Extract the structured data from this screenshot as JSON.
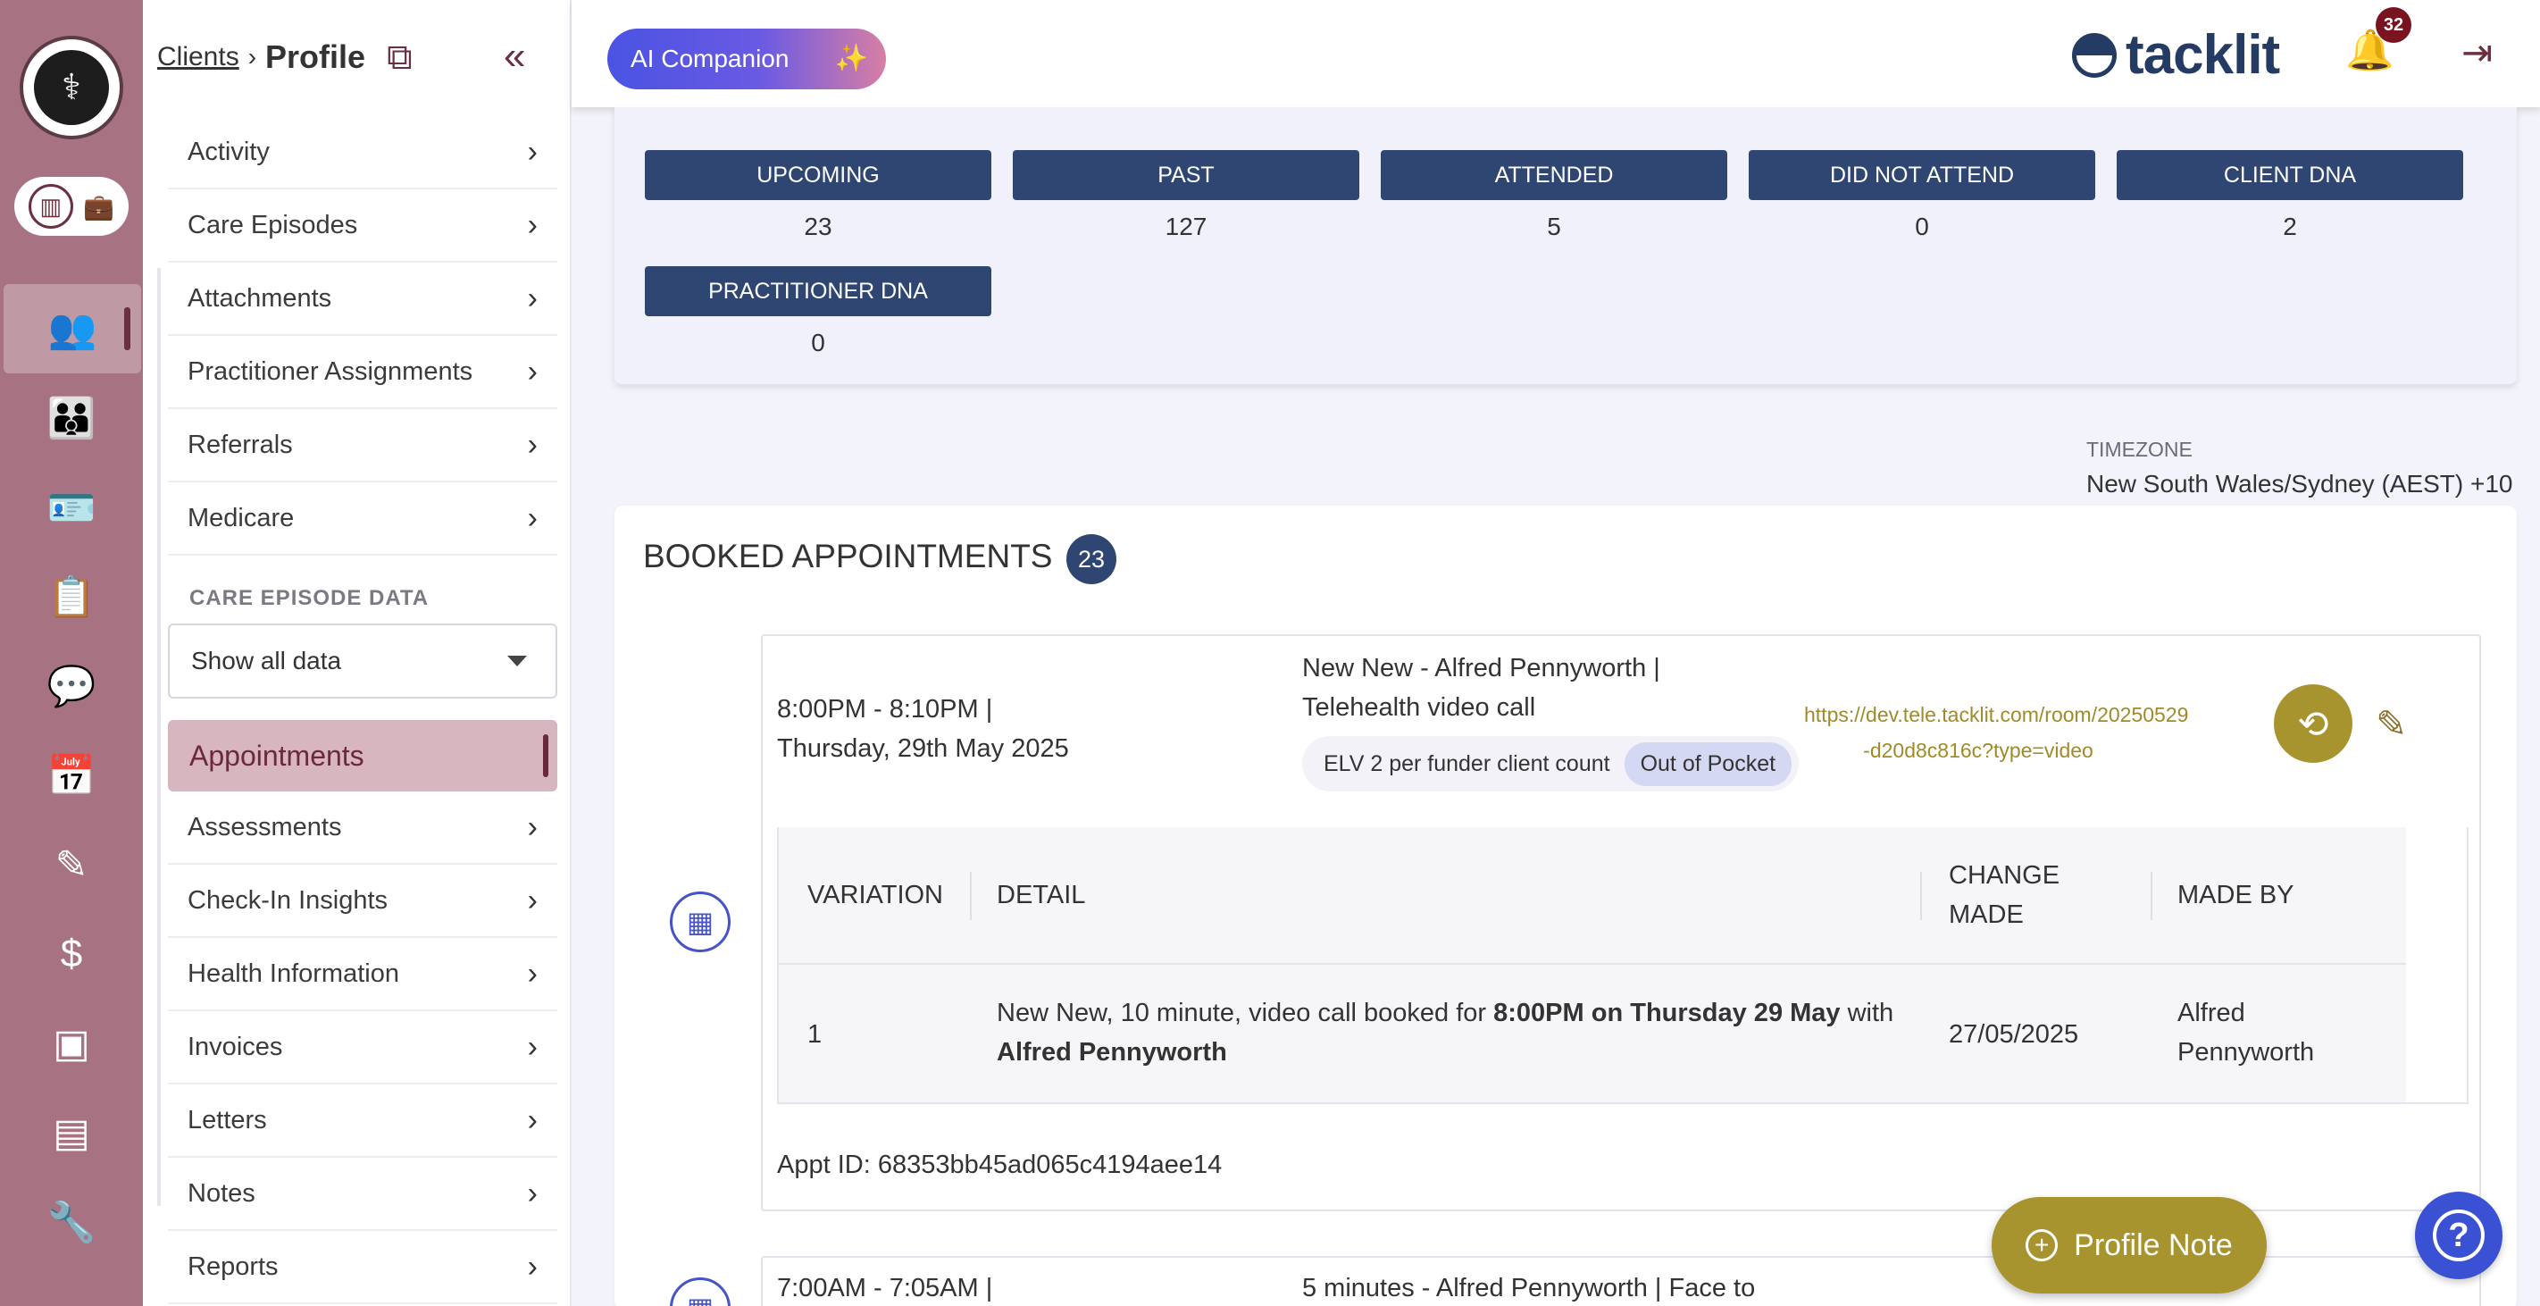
{
  "rail": {
    "logo_icon": "nurse-logo",
    "toggle_icons": [
      "building-icon",
      "briefcase-icon"
    ],
    "items": [
      {
        "icon": "users-icon",
        "glyph": "👥"
      },
      {
        "icon": "group-icon",
        "glyph": "👪"
      },
      {
        "icon": "id-card-icon",
        "glyph": "🪪"
      },
      {
        "icon": "clipboard-icon",
        "glyph": "📋"
      },
      {
        "icon": "chat-icon",
        "glyph": "💬"
      },
      {
        "icon": "calendar-icon",
        "glyph": "📅"
      },
      {
        "icon": "pen-icon",
        "glyph": "✎"
      },
      {
        "icon": "dollar-icon",
        "glyph": "$"
      },
      {
        "icon": "contact-card-icon",
        "glyph": "▣"
      },
      {
        "icon": "document-icon",
        "glyph": "▤"
      },
      {
        "icon": "wrench-icon",
        "glyph": "🔧"
      }
    ]
  },
  "breadcrumb": {
    "parent": "Clients",
    "separator": "›",
    "current": "Profile"
  },
  "menu_top": [
    "Activity",
    "Care Episodes",
    "Attachments",
    "Practitioner Assignments",
    "Referrals",
    "Medicare"
  ],
  "care_episode": {
    "label": "CARE EPISODE DATA",
    "selected": "Show all data"
  },
  "menu_active": "Appointments",
  "menu_bottom": [
    "Assessments",
    "Check-In Insights",
    "Health Information",
    "Invoices",
    "Letters",
    "Notes",
    "Reports"
  ],
  "topbar": {
    "ai_label": "AI Companion",
    "brand": "tacklit",
    "notifications": "32"
  },
  "stats": [
    {
      "label": "UPCOMING",
      "value": "23"
    },
    {
      "label": "PAST",
      "value": "127"
    },
    {
      "label": "ATTENDED",
      "value": "5"
    },
    {
      "label": "DID NOT ATTEND",
      "value": "0"
    },
    {
      "label": "CLIENT DNA",
      "value": "2"
    },
    {
      "label": "PRACTITIONER DNA",
      "value": "0"
    }
  ],
  "timezone": {
    "label": "TIMEZONE",
    "value": "New South Wales/Sydney (AEST) +10"
  },
  "booked": {
    "title": "BOOKED APPOINTMENTS",
    "count": "23"
  },
  "appointment": {
    "time_line1": "8:00PM - 8:10PM |",
    "time_line2": "Thursday, 29th May 2025",
    "title_line1": "New New - Alfred Pennyworth |",
    "title_line2": "Telehealth video call",
    "tag_funder": "ELV 2 per funder client count",
    "tag_payment": "Out of Pocket",
    "link_line1": "https://dev.tele.tacklit.com/room/20250529",
    "link_line2": "-d20d8c816c?type=video",
    "table": {
      "headers": {
        "variation": "VARIATION",
        "detail": "DETAIL",
        "change_1": "CHANGE",
        "change_2": "MADE",
        "made_by": "MADE BY"
      },
      "row": {
        "variation": "1",
        "detail_pre": "New New, 10 minute, video call booked for ",
        "detail_bold": "8:00PM on Thursday 29 May",
        "detail_mid": " with",
        "detail_name": "Alfred Pennyworth",
        "change_made": "27/05/2025",
        "made_by_1": "Alfred",
        "made_by_2": "Pennyworth"
      }
    },
    "appt_id": "Appt ID: 68353bb45ad065c4194aee14"
  },
  "appointment2": {
    "time_line1": "7:00AM - 7:05AM |",
    "title_line1": "5 minutes - Alfred Pennyworth | Face to"
  },
  "profile_note": "Profile Note",
  "help": "?"
}
